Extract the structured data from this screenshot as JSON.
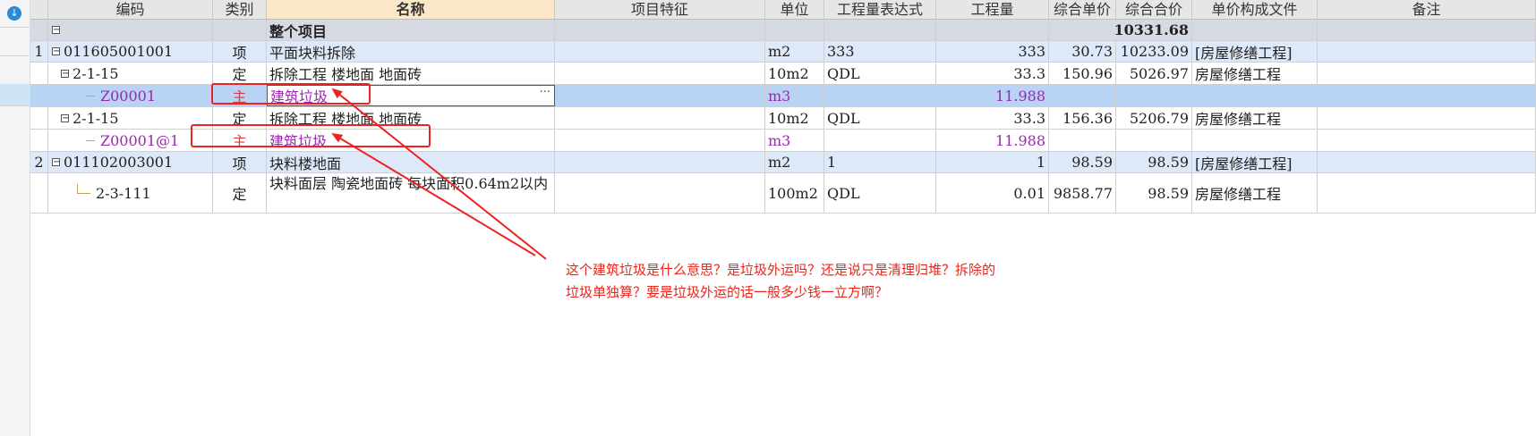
{
  "sidebar": {
    "top_button_icon": "download-icon"
  },
  "headers": {
    "index": "",
    "code": "编码",
    "type": "类别",
    "name": "名称",
    "feature": "项目特征",
    "unit": "单位",
    "expr": "工程量表达式",
    "qty": "工程量",
    "price": "综合单价",
    "total": "综合合价",
    "file": "单价构成文件",
    "remark": "备注"
  },
  "rows": [
    {
      "index": "",
      "toggle": "−",
      "code": "",
      "type": "",
      "name": "整个项目",
      "unit": "",
      "expr": "",
      "qty": "",
      "price": "",
      "total": "10331.68",
      "file": "",
      "remark": ""
    },
    {
      "index": "1",
      "toggle": "−",
      "code": "011605001001",
      "type": "项",
      "name": "平面块料拆除",
      "unit": "m2",
      "expr": "333",
      "qty": "333",
      "price": "30.73",
      "total": "10233.09",
      "file": "[房屋修缮工程]",
      "remark": ""
    },
    {
      "index": "",
      "toggle": "−",
      "code": "2-1-15",
      "type": "定",
      "name": "拆除工程 楼地面 地面砖",
      "unit": "10m2",
      "expr": "QDL",
      "qty": "33.3",
      "price": "150.96",
      "total": "5026.97",
      "file": "房屋修缮工程",
      "remark": ""
    },
    {
      "index": "",
      "toggle": "",
      "code": "Z00001",
      "type": "主",
      "name": "建筑垃圾",
      "unit": "m3",
      "expr": "",
      "qty": "11.988",
      "price": "",
      "total": "",
      "file": "",
      "remark": ""
    },
    {
      "index": "",
      "toggle": "−",
      "code": "2-1-15",
      "type": "定",
      "name": "拆除工程 楼地面 地面砖",
      "unit": "10m2",
      "expr": "QDL",
      "qty": "33.3",
      "price": "156.36",
      "total": "5206.79",
      "file": "房屋修缮工程",
      "remark": ""
    },
    {
      "index": "",
      "toggle": "",
      "code": "Z00001@1",
      "type": "主",
      "name": "建筑垃圾",
      "unit": "m3",
      "expr": "",
      "qty": "11.988",
      "price": "",
      "total": "",
      "file": "",
      "remark": ""
    },
    {
      "index": "2",
      "toggle": "−",
      "code": "011102003001",
      "type": "项",
      "name": "块料楼地面",
      "unit": "m2",
      "expr": "1",
      "qty": "1",
      "price": "98.59",
      "total": "98.59",
      "file": "[房屋修缮工程]",
      "remark": ""
    },
    {
      "index": "",
      "toggle": "",
      "code": "2-3-111",
      "type": "定",
      "name": "块料面层 陶瓷地面砖 每块面积0.64m2以内",
      "unit": "100m2",
      "expr": "QDL",
      "qty": "0.01",
      "price": "9858.77",
      "total": "98.59",
      "file": "房屋修缮工程",
      "remark": ""
    }
  ],
  "ellipsis_label": "···",
  "annotation": {
    "line1": "这个建筑垃圾是什么意思？是垃圾外运吗？还是说只是清理归堆？拆除的",
    "line2": "垃圾单独算？要是垃圾外运的话一般多少钱一立方啊？"
  },
  "colors": {
    "header_bg": "#e6e6e6",
    "name_header_bg": "#fbe8c8",
    "group_row_bg": "#dde8f8",
    "selected_row_bg": "#b8d3f4",
    "material_text": "#9c27b0",
    "annotation_red": "#e8261b"
  }
}
